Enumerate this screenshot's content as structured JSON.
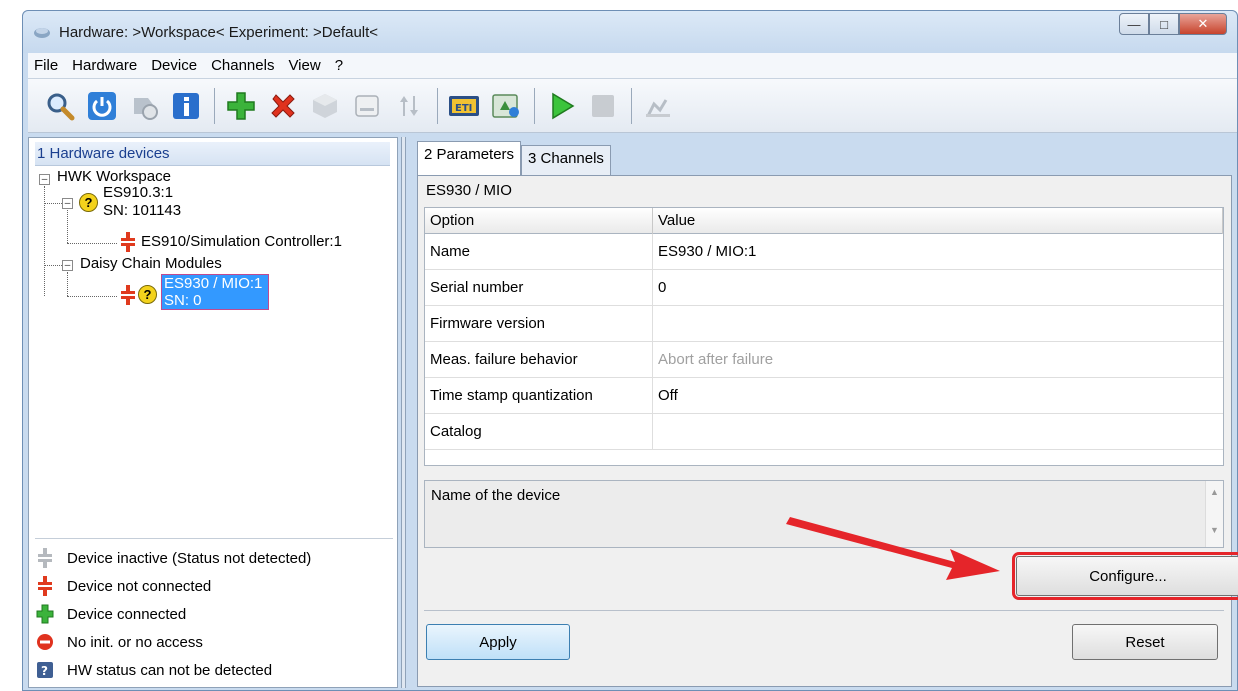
{
  "window": {
    "title": "Hardware: >Workspace<   Experiment: >Default<",
    "controls": [
      "minimize",
      "maximize",
      "close"
    ]
  },
  "menu": [
    "File",
    "Hardware",
    "Device",
    "Channels",
    "View",
    "?"
  ],
  "toolbar_icons": [
    "search-icon",
    "power-icon",
    "disconnect-icon",
    "info-icon",
    "add-icon",
    "delete-icon",
    "cube-icon",
    "id-card-icon",
    "sort-icon",
    "calibrate-icon",
    "refresh-icon",
    "play-icon",
    "stop-icon",
    "export-icon"
  ],
  "left": {
    "header": "1 Hardware devices",
    "tree": {
      "root": "HWK Workspace",
      "es910_line1": "ES910.3:1",
      "es910_line2": "SN: 101143",
      "sim_controller": "ES910/Simulation Controller:1",
      "daisy": "Daisy Chain Modules",
      "es930_line1": "ES930 / MIO:1",
      "es930_line2": "SN: 0"
    },
    "legend": [
      {
        "icon": "device-inactive-icon",
        "label": "Device inactive (Status not detected)"
      },
      {
        "icon": "device-not-connected-icon",
        "label": "Device not connected"
      },
      {
        "icon": "device-connected-icon",
        "label": "Device connected"
      },
      {
        "icon": "no-access-icon",
        "label": "No init. or no access"
      },
      {
        "icon": "unknown-status-icon",
        "label": "HW status can not be detected"
      }
    ]
  },
  "right": {
    "tabs": [
      "2 Parameters",
      "3 Channels"
    ],
    "panel_title": "ES930 / MIO",
    "columns": [
      "Option",
      "Value"
    ],
    "rows": [
      {
        "option": "Name",
        "value": "ES930 / MIO:1",
        "disabled": false
      },
      {
        "option": "Serial number",
        "value": "0",
        "disabled": false
      },
      {
        "option": "Firmware version",
        "value": "",
        "disabled": false
      },
      {
        "option": "Meas. failure behavior",
        "value": "Abort after failure",
        "disabled": true
      },
      {
        "option": "Time stamp quantization",
        "value": "Off",
        "disabled": false
      },
      {
        "option": "Catalog",
        "value": "",
        "disabled": false
      }
    ],
    "description": "Name of the device",
    "configure_label": "Configure...",
    "apply_label": "Apply",
    "reset_label": "Reset"
  },
  "colors": {
    "accent": "#e5252a",
    "selection": "#3399ff"
  }
}
